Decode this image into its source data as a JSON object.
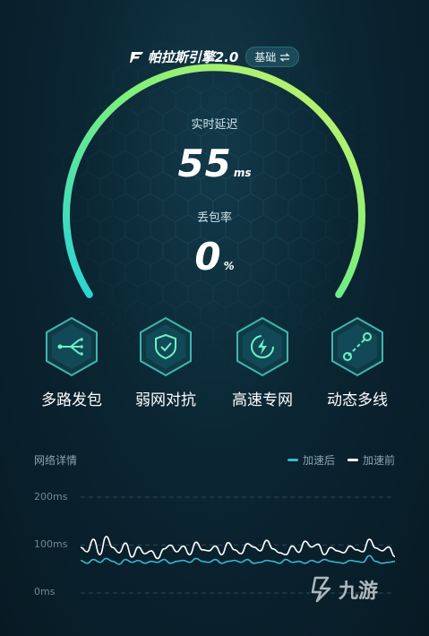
{
  "header": {
    "engine_name": "帕拉斯引擎2.0",
    "mode_label": "基础",
    "switch_icon": "swap-icon"
  },
  "gauge": {
    "latency_label": "实时延迟",
    "latency_value": "55",
    "latency_unit": "ms",
    "loss_label": "丢包率",
    "loss_value": "0",
    "loss_unit": "%",
    "arc_colors": [
      "#27d4d8",
      "#7ef07a",
      "#d4f06a"
    ]
  },
  "features": [
    {
      "label": "多路发包",
      "icon": "multipath-icon"
    },
    {
      "label": "弱网对抗",
      "icon": "shield-check-icon"
    },
    {
      "label": "高速专网",
      "icon": "lightning-icon"
    },
    {
      "label": "动态多线",
      "icon": "route-icon"
    }
  ],
  "network": {
    "title": "网络详情",
    "legend_after": "加速后",
    "legend_before": "加速前",
    "after_color": "#38b9d0",
    "before_color": "#ffffff",
    "y_labels": [
      "200ms",
      "100ms",
      "0ms"
    ]
  },
  "chart_data": {
    "type": "line",
    "ylim": [
      0,
      200
    ],
    "yticks": [
      "200ms",
      "100ms",
      "0ms"
    ],
    "series": [
      {
        "name": "加速前",
        "values": [
          95,
          86,
          112,
          80,
          118,
          95,
          84,
          104,
          75,
          96,
          82,
          88,
          72,
          92,
          100,
          86,
          98,
          80,
          106,
          90,
          88,
          98,
          80,
          105,
          90,
          82,
          103,
          96,
          88,
          110,
          92,
          84,
          80,
          98,
          85,
          108,
          96,
          102,
          80,
          95,
          88,
          84,
          98,
          90,
          86,
          112,
          94,
          88,
          96,
          76
        ]
      },
      {
        "name": "加速后",
        "values": [
          68,
          62,
          70,
          64,
          72,
          66,
          60,
          70,
          64,
          68,
          62,
          66,
          64,
          70,
          62,
          66,
          68,
          64,
          72,
          66,
          64,
          70,
          62,
          66,
          68,
          64,
          70,
          62,
          64,
          68,
          66,
          62,
          70,
          64,
          66,
          62,
          68,
          64,
          70,
          66,
          64,
          62,
          68,
          66,
          64,
          78,
          66,
          62,
          64,
          66
        ]
      }
    ]
  },
  "watermark": {
    "text": "九游"
  }
}
